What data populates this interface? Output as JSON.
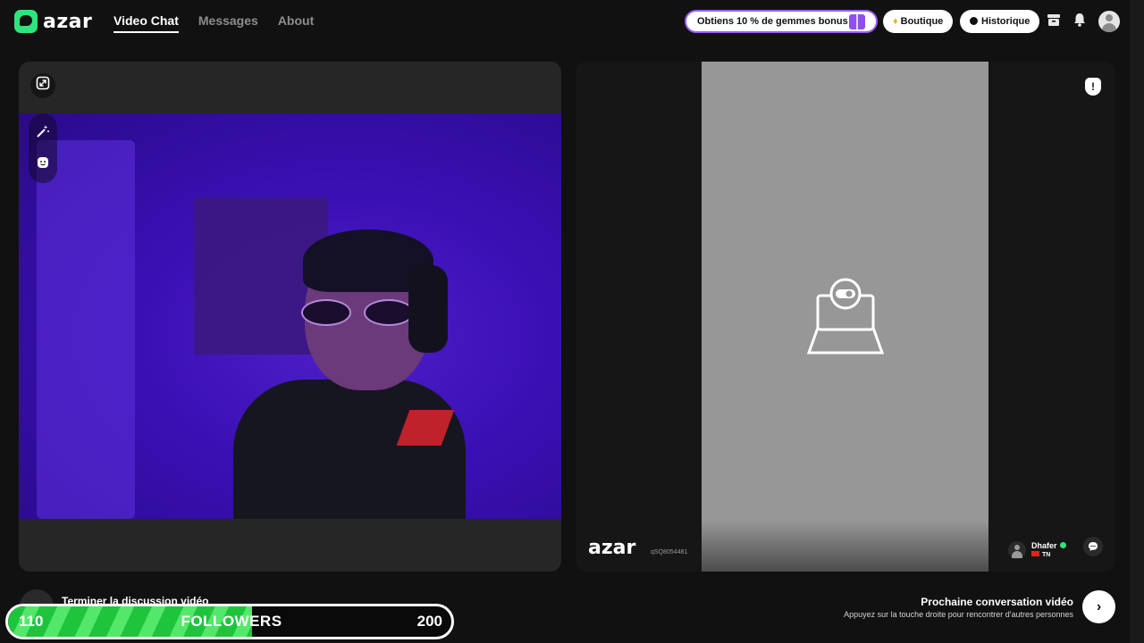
{
  "header": {
    "brand": "azar",
    "tabs": [
      {
        "label": "Video Chat",
        "active": true
      },
      {
        "label": "Messages",
        "active": false
      },
      {
        "label": "About",
        "active": false
      }
    ],
    "promo_label": "Obtiens 10 % de gemmes bonus !",
    "shop_label": "Boutique",
    "history_label": "Historique",
    "icons": [
      "inbox-icon",
      "bell-icon",
      "user-avatar"
    ]
  },
  "self_view": {
    "tools": [
      "expand-icon",
      "magic-wand-icon",
      "sticker-smiley-icon"
    ]
  },
  "remote_view": {
    "placeholder_icon": "webcam-off-icon",
    "watermark": "azar",
    "stream_id": "qSQ8054481",
    "peer": {
      "name": "Dhafer",
      "country": "TN",
      "verified": true
    },
    "icons": [
      "report-shield-icon",
      "chat-bubble-icon"
    ]
  },
  "bottom": {
    "end_label": "Terminer la discussion vidéo",
    "next_title": "Prochaine conversation vidéo",
    "next_subtitle": "Appuyez sur la touche droite pour rencontrer d'autres personnes"
  },
  "follower_goal": {
    "current": "110",
    "label": "FOLLOWERS",
    "target": "200",
    "progress_fraction": 0.55
  },
  "colors": {
    "background": "#111111",
    "brand_green": "#2fe37d",
    "promo_border": "#9a5cf6",
    "progress_green": "#1fc43d"
  }
}
